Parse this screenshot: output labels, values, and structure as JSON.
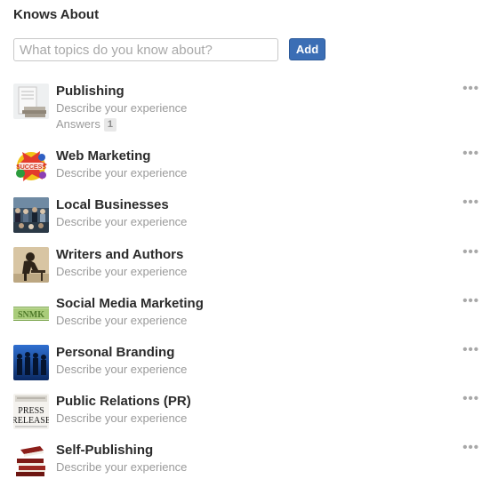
{
  "section": {
    "title": "Knows About"
  },
  "search": {
    "placeholder": "What topics do you know about?",
    "value": ""
  },
  "add_button": {
    "label": "Add"
  },
  "more_label": "•••",
  "topics": [
    {
      "name": "Publishing",
      "description": "Describe your experience",
      "answers_label": "Answers",
      "answers_count": "1",
      "icon": "books-stack-icon"
    },
    {
      "name": "Web Marketing",
      "description": "Describe your experience",
      "icon": "success-splash-icon"
    },
    {
      "name": "Local Businesses",
      "description": "Describe your experience",
      "icon": "crowd-market-icon"
    },
    {
      "name": "Writers and Authors",
      "description": "Describe your experience",
      "icon": "writer-silhouette-icon"
    },
    {
      "name": "Social Media Marketing",
      "description": "Describe your experience",
      "icon": "social-media-banner-icon"
    },
    {
      "name": "Personal Branding",
      "description": "Describe your experience",
      "icon": "business-people-icon"
    },
    {
      "name": "Public Relations (PR)",
      "description": "Describe your experience",
      "icon": "press-release-icon"
    },
    {
      "name": "Self-Publishing",
      "description": "Describe your experience",
      "icon": "book-stack-icon"
    }
  ]
}
